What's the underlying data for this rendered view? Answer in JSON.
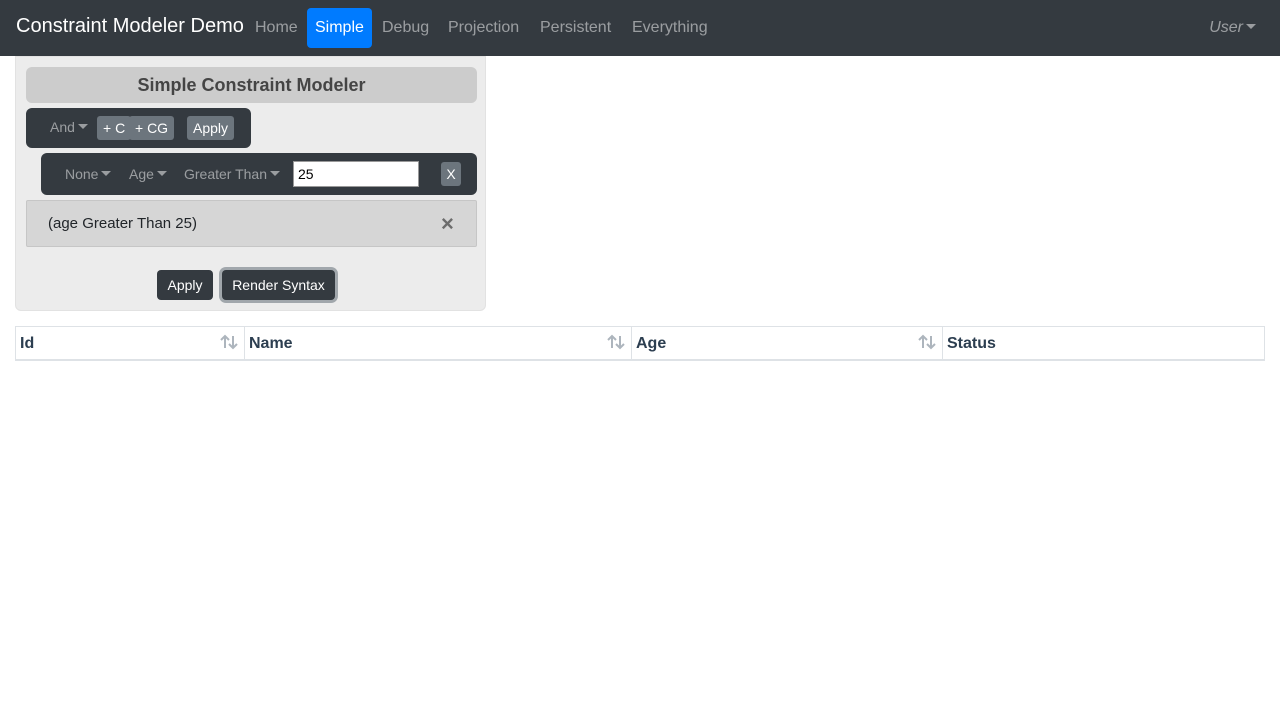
{
  "navbar": {
    "brand": "Constraint Modeler Demo",
    "links": [
      {
        "label": "Home",
        "active": false
      },
      {
        "label": "Simple",
        "active": true
      },
      {
        "label": "Debug",
        "active": false
      },
      {
        "label": "Projection",
        "active": false
      },
      {
        "label": "Persistent",
        "active": false
      },
      {
        "label": "Everything",
        "active": false
      }
    ],
    "user_label": "User",
    "active_color": "#007bff"
  },
  "modeler": {
    "title": "Simple Constraint Modeler",
    "group": {
      "operator": "And",
      "add_constraint_label": "+ C",
      "add_group_label": "+ CG",
      "apply_label": "Apply"
    },
    "condition": {
      "negation": "None",
      "field": "Age",
      "comparator": "Greater Than",
      "value": "25",
      "remove_label": "X"
    },
    "syntax": "(age Greater Than 25)",
    "close_glyph": "×",
    "apply_label": "Apply",
    "render_syntax_label": "Render Syntax"
  },
  "table": {
    "columns": [
      {
        "label": "Id",
        "sortable": true
      },
      {
        "label": "Name",
        "sortable": true
      },
      {
        "label": "Age",
        "sortable": true
      },
      {
        "label": "Status",
        "sortable": false
      }
    ],
    "rows": []
  }
}
